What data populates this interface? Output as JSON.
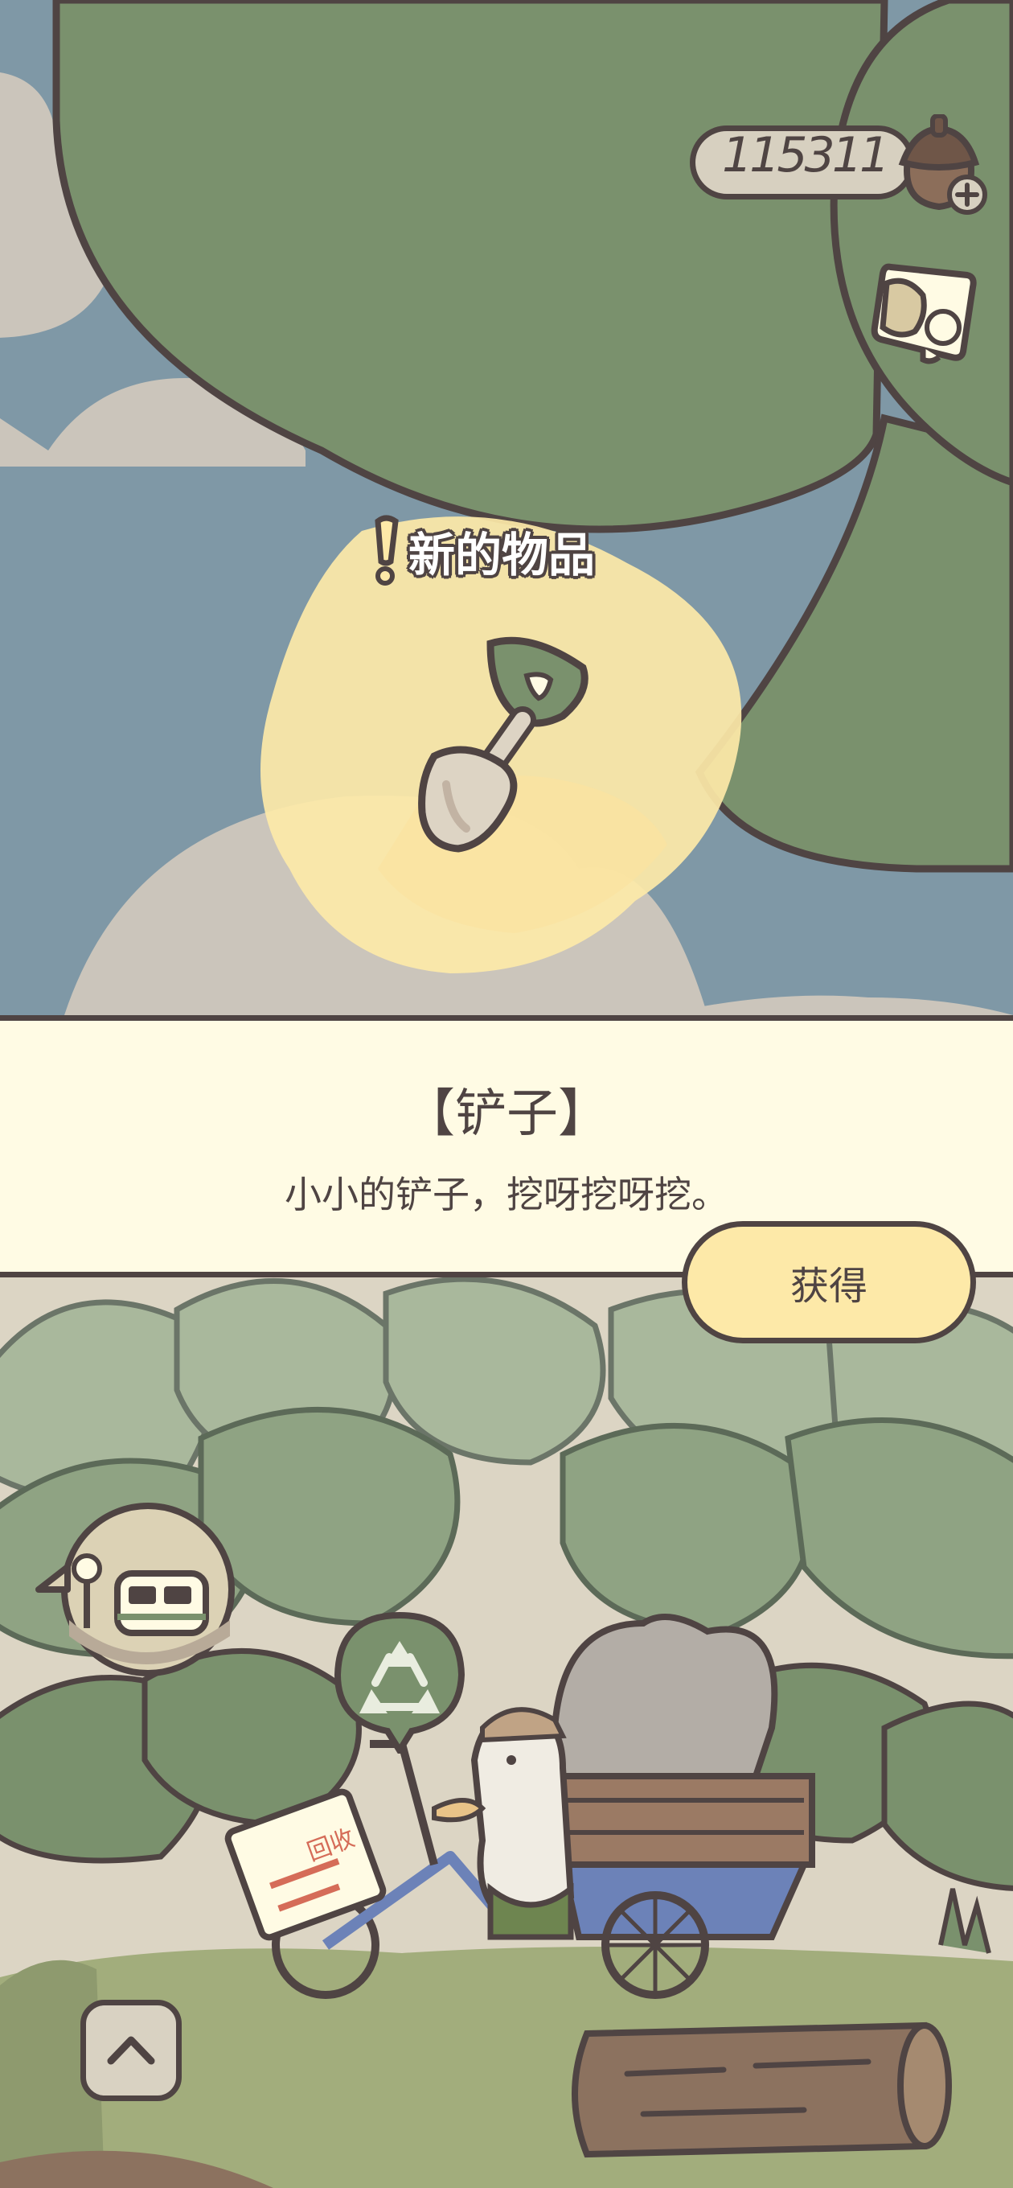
{
  "hud": {
    "currency_value": "115311",
    "currency_icon": "acorn-icon",
    "currency_add_icon": "plus-icon",
    "ticket_icon": "ticket-icon"
  },
  "reward": {
    "badge": "新的物品",
    "badge_icon": "exclamation-icon",
    "item_icon": "shovel-icon"
  },
  "dialog": {
    "title": "【铲子】",
    "description": "小小的铲子，挖呀挖呀挖。",
    "obtain_label": "获得"
  },
  "scene": {
    "bus_stop_icon": "bus-stop-icon",
    "recycle_icon": "recycle-icon",
    "sign_text": "回收",
    "up_icon": "chevron-up-icon"
  },
  "colors": {
    "outline": "#4f4443",
    "sky": "#7f98a6",
    "tree": "#7a916d",
    "glow": "#fde9a8",
    "dialog_bg": "#fffbe4"
  }
}
